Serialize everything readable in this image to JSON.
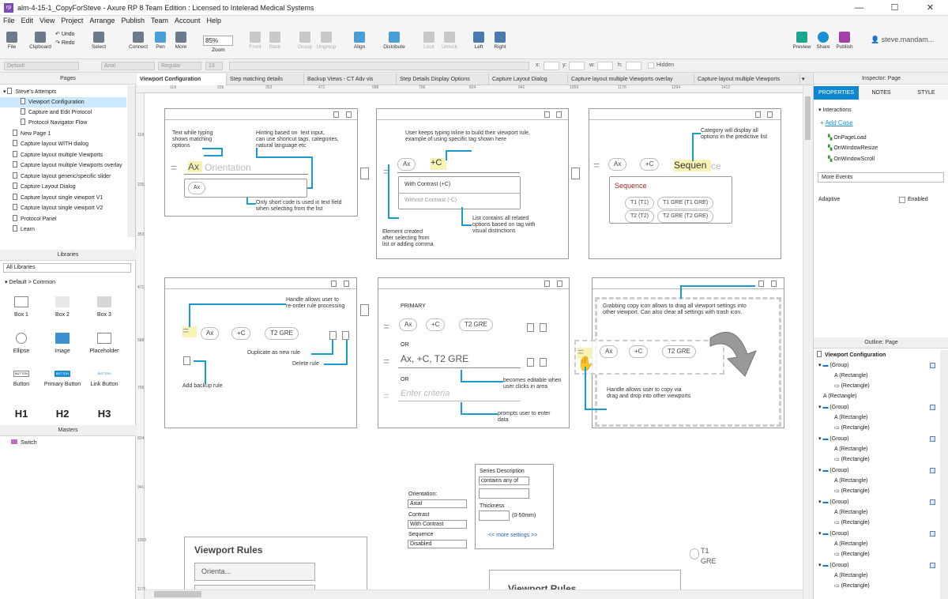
{
  "window": {
    "title": "alm-4-15-1_CopyForSteve - Axure RP 8 Team Edition : Licensed to Intelerad Medical Systems",
    "app_icon": "rp",
    "minimize": "—",
    "maximize": "☐",
    "close": "✕"
  },
  "menu": [
    "File",
    "Edit",
    "View",
    "Project",
    "Arrange",
    "Publish",
    "Team",
    "Account",
    "Help"
  ],
  "toolbar": {
    "file": "File",
    "clipboard": "Clipboard",
    "undo": "Undo",
    "redo": "Redo",
    "select": "Select",
    "connect": "Connect",
    "pen": "Pen",
    "more": "More",
    "zoom_value": "85%",
    "zoom": "Zoom",
    "front": "Front",
    "back": "Back",
    "group": "Group",
    "ungroup": "Ungroup",
    "align": "Align",
    "distribute": "Distribute",
    "lock": "Lock",
    "unlock": "Unlock",
    "left": "Left",
    "right": "Right",
    "preview": "Preview",
    "share": "Share",
    "publish": "Publish",
    "user": "steve.mandam..."
  },
  "format": {
    "style": "Default",
    "font": "Arial",
    "weight": "Regular",
    "size": "13",
    "x": "x:",
    "y": "y:",
    "w": "w:",
    "h": "h:",
    "hidden": "Hidden"
  },
  "pages_panel": {
    "title": "Pages",
    "items": [
      {
        "label": "Steve's Attempts",
        "level": 0
      },
      {
        "label": "Viewport Configuration",
        "level": 1,
        "selected": true
      },
      {
        "label": "Capture and Edit Protocol",
        "level": 1
      },
      {
        "label": "Protocol Navigator Flow",
        "level": 1
      },
      {
        "label": "New Page 1",
        "level": 0
      },
      {
        "label": "Capture layout WITH dialog",
        "level": 0
      },
      {
        "label": "Capture layout multiple Viewports",
        "level": 0
      },
      {
        "label": "Capture layout multiple Viewports overlay",
        "level": 0
      },
      {
        "label": "Capture layout generic/specific slider",
        "level": 0
      },
      {
        "label": "Capture Layout Dialog",
        "level": 0
      },
      {
        "label": "Capture layout single viewport V1",
        "level": 0
      },
      {
        "label": "Capture layout single viewport V2",
        "level": 0
      },
      {
        "label": "Protocol Panel",
        "level": 0
      },
      {
        "label": "Learn",
        "level": 0
      }
    ]
  },
  "libraries_panel": {
    "title": "Libraries",
    "selector": "All Libraries",
    "group": "Default > Common",
    "items": [
      "Box 1",
      "Box 2",
      "Box 3",
      "Ellipse",
      "Image",
      "Placeholder",
      "Button",
      "Primary Button",
      "Link Button",
      "H1",
      "H2",
      "H3"
    ],
    "button_text": "BUTTON"
  },
  "masters_panel": {
    "title": "Masters",
    "items": [
      "Switch"
    ]
  },
  "tabs": [
    "Viewport Configuration",
    "Step matching details",
    "Backup Views - CT Adv vis",
    "Step Details Display Options",
    "Capture Layout Dialog",
    "Capture layout multiple Viewports overlay",
    "Capture layout multiple Viewports"
  ],
  "rulers": {
    "top": [
      "118",
      "235",
      "353",
      "471",
      "588",
      "706",
      "824",
      "941",
      "1059",
      "1176",
      "1294",
      "1412"
    ],
    "left": [
      "118",
      "235",
      "353",
      "471",
      "588",
      "706",
      "824",
      "941",
      "1059",
      "1176"
    ]
  },
  "canvas": {
    "c1": {
      "n1": "Text while typing\nshows matching\noptions",
      "n2": "Hinting based on  text input,\ncan use shortcut tags, categories,\nnatural language etc",
      "typed": "Ax",
      "placeholder": " Orientation",
      "chip": "Ax",
      "n3": "Only short code is used in text field\nwhen selecting from the list"
    },
    "c2": {
      "n1": "User keeps typing inline to build their viewport rule,\nexample of using specific tag shown here",
      "chip": "Ax",
      "typed": "+C",
      "opt1": "With Contrast (+C)",
      "opt2": "Without Contrast (-C)",
      "n2": "Element created\nafter selecting from\nlist or adding comma",
      "n3": "List contains all related\noptions based on tag with\nvisual distinctions"
    },
    "c3": {
      "n1": "Category will display all\noptions in the predictive list",
      "chip1": "Ax",
      "chip2": "+C",
      "typed": "Sequen",
      "rest": "ce",
      "heading": "Sequence",
      "o1": "T1 (T1)",
      "o2": "T1 GRE (T1 GRE)",
      "o3": "T2 (T2)",
      "o4": "T2 GRE (T2 GRE)"
    },
    "c4": {
      "n1": "Handle allows user to\nre-order rule processing",
      "chip1": "Ax",
      "chip2": "+C",
      "chip3": "T2 GRE",
      "n2": "Duplicate as new rule",
      "n3": "Delete rule",
      "n4": "Add backup rule"
    },
    "c5": {
      "primary": "PRIMARY",
      "chip1": "Ax",
      "chip2": "+C",
      "chip3": "T2 GRE",
      "or1": "OR",
      "text": "Ax, +C, T2 GRE",
      "or2": "OR",
      "placeholder": "Enter criteria",
      "n1": "becomes editable when\nuser clicks in area",
      "n2": "prompts user to enter\ndata"
    },
    "c6": {
      "n1": "Grabbing copy icon allows to drag all viewport settings into\nother viewport. Can also clear all settings with trash icon.",
      "chip1": "Ax",
      "chip2": "+C",
      "chip3": "T2 GRE",
      "n2": "Handle allows user to copy via\ndrag and drop into other viewports"
    },
    "form": {
      "orientation_label": "Orientation:",
      "orientation": "Axial",
      "contrast_label": "Contrast",
      "contrast": "With Contrast",
      "sequence_label": "Sequence",
      "sequence": "Disabled"
    },
    "series": {
      "title": "Series Description",
      "match": "contains any of",
      "thickness": "Thickness",
      "range": "(0-50mm)",
      "more": "<< more settings >>"
    },
    "rules1": {
      "title": "Viewport Rules",
      "field": "Orienta..."
    },
    "rules2": {
      "title": "Viewport Rules"
    },
    "t1": {
      "line1": "T1",
      "line2": "GRE"
    }
  },
  "inspector": {
    "title": "Inspector: Page",
    "tabs": [
      "PROPERTIES",
      "NOTES",
      "STYLE"
    ],
    "interactions": "Interactions",
    "add_case": "Add Case",
    "events": [
      "OnPageLoad",
      "OnWindowResize",
      "OnWindowScroll"
    ],
    "more_events": "More Events",
    "adaptive": "Adaptive",
    "enabled": "Enabled"
  },
  "outline": {
    "title": "Outline: Page",
    "root": "Viewport Configuration",
    "items": [
      {
        "label": "(Group)",
        "level": 1,
        "type": "group"
      },
      {
        "label": "(Rectangle)",
        "level": 2,
        "type": "text"
      },
      {
        "label": "(Rectangle)",
        "level": 2,
        "type": "rect"
      },
      {
        "label": "(Rectangle)",
        "level": 1,
        "type": "text"
      },
      {
        "label": "(Group)",
        "level": 1,
        "type": "group"
      },
      {
        "label": "(Rectangle)",
        "level": 2,
        "type": "text"
      },
      {
        "label": "(Rectangle)",
        "level": 2,
        "type": "rect"
      },
      {
        "label": "(Group)",
        "level": 1,
        "type": "group"
      },
      {
        "label": "(Rectangle)",
        "level": 2,
        "type": "text"
      },
      {
        "label": "(Rectangle)",
        "level": 2,
        "type": "rect"
      },
      {
        "label": "(Group)",
        "level": 1,
        "type": "group"
      },
      {
        "label": "(Rectangle)",
        "level": 2,
        "type": "text"
      },
      {
        "label": "(Rectangle)",
        "level": 2,
        "type": "rect"
      },
      {
        "label": "(Group)",
        "level": 1,
        "type": "group"
      },
      {
        "label": "(Rectangle)",
        "level": 2,
        "type": "text"
      },
      {
        "label": "(Rectangle)",
        "level": 2,
        "type": "rect"
      },
      {
        "label": "(Group)",
        "level": 1,
        "type": "group"
      },
      {
        "label": "(Rectangle)",
        "level": 2,
        "type": "text"
      },
      {
        "label": "(Rectangle)",
        "level": 2,
        "type": "rect"
      },
      {
        "label": "(Group)",
        "level": 1,
        "type": "group"
      },
      {
        "label": "(Rectangle)",
        "level": 2,
        "type": "text"
      },
      {
        "label": "(Rectangle)",
        "level": 2,
        "type": "rect"
      }
    ]
  },
  "colors": {
    "accent": "#1a9ccf",
    "inspector_tab": "#0f86d0",
    "highlight": "#f8f3b3",
    "selection": "#cce8ff",
    "sequence_red": "#a0262a"
  }
}
